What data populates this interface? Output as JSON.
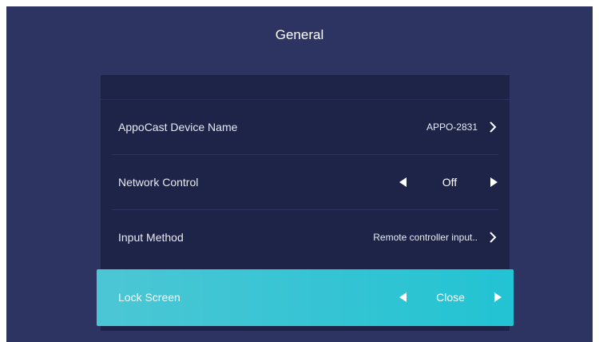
{
  "header": {
    "title": "General"
  },
  "settings": {
    "items": [
      {
        "label": "AppoCast Device Name",
        "value": "APPO-2831",
        "control": "link"
      },
      {
        "label": "Network Control",
        "value": "Off",
        "control": "toggle"
      },
      {
        "label": "Input Method",
        "value": "Remote controller input..",
        "control": "link"
      },
      {
        "label": "Lock Screen",
        "value": "Close",
        "control": "toggle",
        "focused": true
      }
    ]
  },
  "colors": {
    "background": "#2e3462",
    "panel": "#1e2448",
    "focus_accent": "#22c3d3",
    "text": "#ffffff"
  },
  "icons": {
    "link_indicator": "chevron-right-icon",
    "toggle_prev": "arrow-left-icon",
    "toggle_next": "arrow-right-icon"
  }
}
